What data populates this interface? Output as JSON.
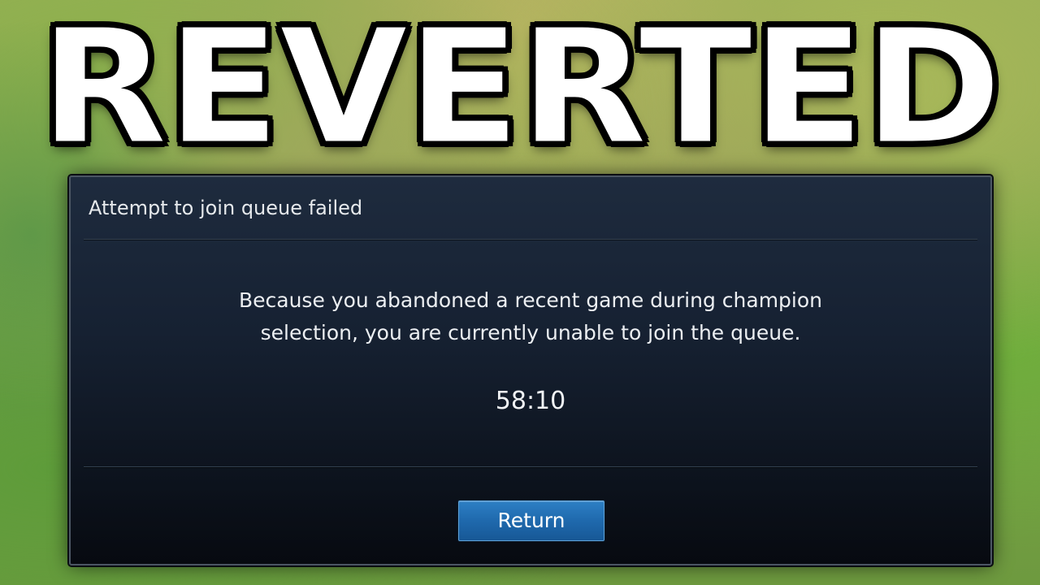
{
  "headline": "REVERTED",
  "dialog": {
    "title": "Attempt to join queue failed",
    "message_line1": "Because you abandoned a recent game during champion",
    "message_line2": "selection, you are currently unable to join the queue.",
    "timer": "58:10",
    "return_label": "Return"
  },
  "colors": {
    "dialog_bg": "#162132",
    "button_blue": "#1f69ad",
    "headline_fill": "#ffffff",
    "headline_stroke": "#000000"
  }
}
